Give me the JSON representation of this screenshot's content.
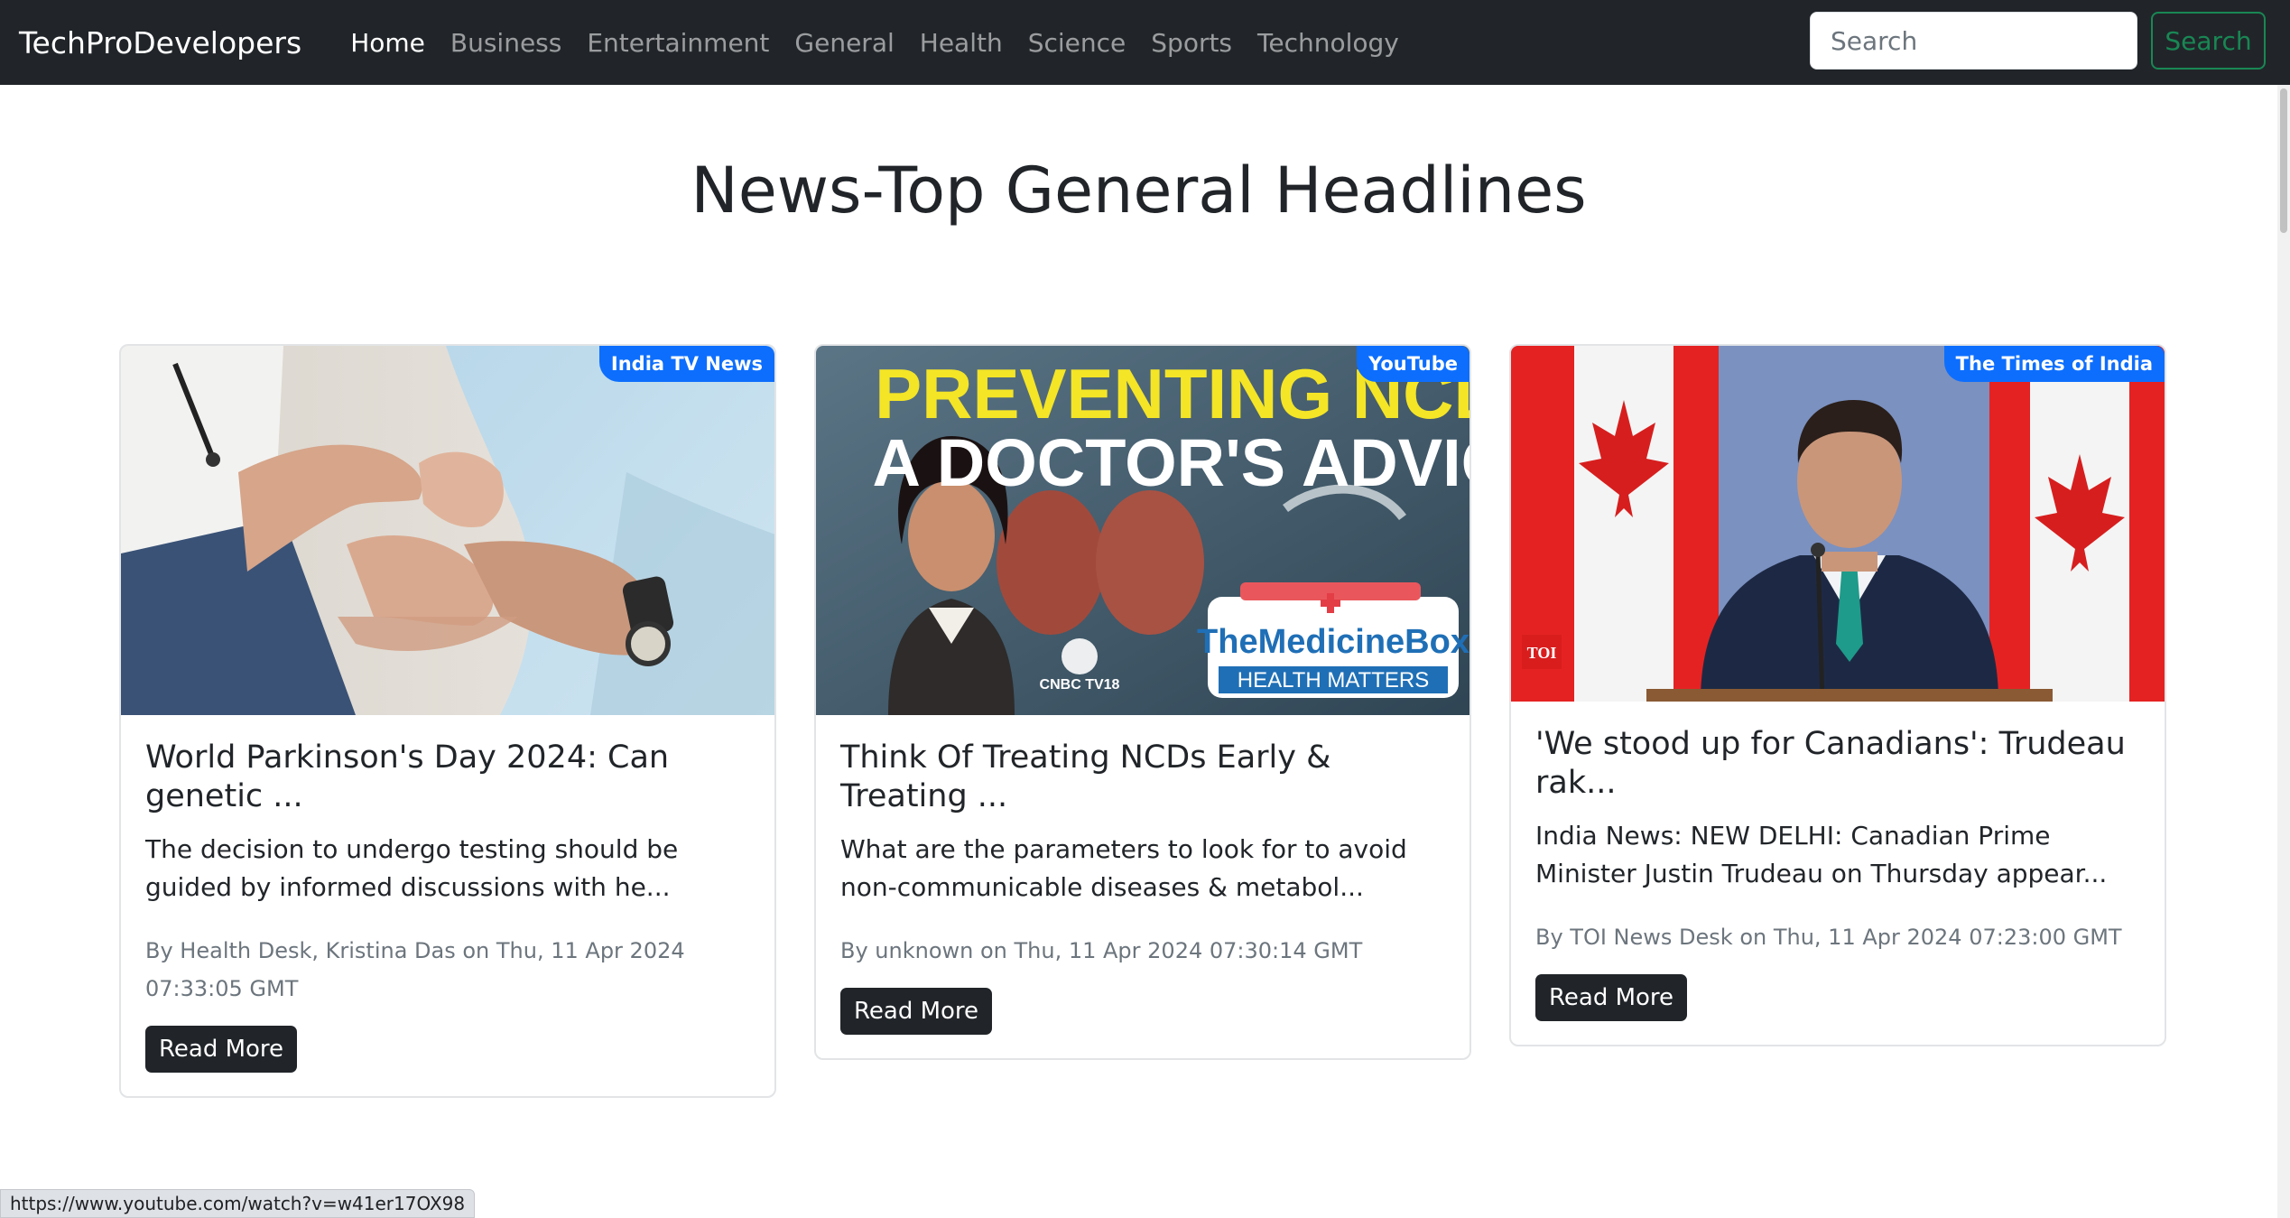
{
  "navbar": {
    "brand": "TechProDevelopers",
    "links": [
      {
        "label": "Home",
        "active": true
      },
      {
        "label": "Business"
      },
      {
        "label": "Entertainment"
      },
      {
        "label": "General"
      },
      {
        "label": "Health"
      },
      {
        "label": "Science"
      },
      {
        "label": "Sports"
      },
      {
        "label": "Technology"
      }
    ],
    "search_placeholder": "Search",
    "search_button": "Search"
  },
  "page_title": "News-Top General Headlines",
  "cards": [
    {
      "source": "India TV News",
      "title": "World Parkinson's Day 2024: Can genetic ...",
      "description": "The decision to undergo testing should be guided by informed discussions with he...",
      "meta": "By Health Desk, Kristina Das on Thu, 11 Apr 2024 07:33:05 GMT",
      "button": "Read More"
    },
    {
      "source": "YouTube",
      "image_text": {
        "line1": "PREVENTING NCDS",
        "line2": "A DOCTOR'S ADVICE",
        "box_title": "TheMedicineBox",
        "box_subtitle": "HEALTH MATTERS",
        "logo": "CNBC TV18"
      },
      "title": "Think Of Treating NCDs Early & Treating ...",
      "description": "What are the parameters to look for to avoid non-communicable diseases & metabol...",
      "meta": "By unknown on Thu, 11 Apr 2024 07:30:14 GMT",
      "button": "Read More"
    },
    {
      "source": "The Times of India",
      "image_text": {
        "logo": "TOI"
      },
      "title": "'We stood up for Canadians': Trudeau rak...",
      "description": "India News: NEW DELHI: Canadian Prime Minister Justin Trudeau on Thursday appear...",
      "meta": "By TOI News Desk on Thu, 11 Apr 2024 07:23:00 GMT",
      "button": "Read More"
    }
  ],
  "status_url": "https://www.youtube.com/watch?v=w41er17OX98",
  "colors": {
    "navbar_bg": "#212529",
    "badge": "#0d6efd",
    "search_outline": "#198754"
  }
}
